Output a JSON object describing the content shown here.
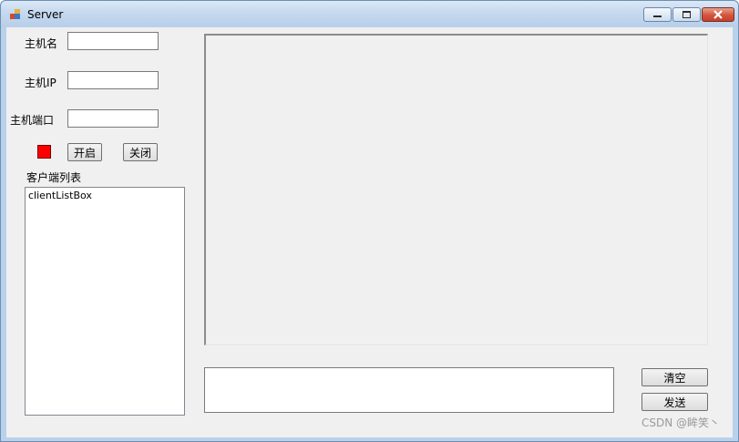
{
  "window": {
    "title": "Server",
    "accent_color": "#b9d1ea",
    "close_color": "#c8402a"
  },
  "form": {
    "host_name_label": "主机名",
    "host_name_value": "",
    "host_ip_label": "主机IP",
    "host_ip_value": "",
    "host_port_label": "主机端口",
    "host_port_value": "",
    "status_color": "#ff0000",
    "start_button": "开启",
    "stop_button": "关闭",
    "client_list_label": "客户端列表",
    "client_list_items": [
      "clientListBox"
    ]
  },
  "message": {
    "log_text": "",
    "input_value": "",
    "clear_button": "清空",
    "send_button": "发送"
  },
  "watermark": "CSDN @眸笑丶"
}
